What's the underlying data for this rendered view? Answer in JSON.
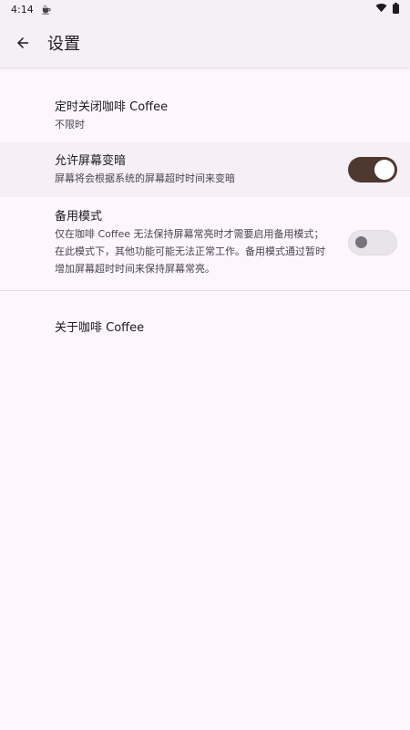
{
  "status_bar": {
    "time": "4:14"
  },
  "app_bar": {
    "title": "设置"
  },
  "settings": {
    "timer": {
      "title": "定时关闭咖啡 Coffee",
      "summary": "不限时"
    },
    "allow_dim": {
      "title": "允许屏幕变暗",
      "summary": "屏幕将会根据系统的屏幕超时时间来变暗",
      "enabled": true
    },
    "backup_mode": {
      "title": "备用模式",
      "summary": "仅在咖啡 Coffee 无法保持屏幕常亮时才需要启用备用模式；在此模式下，其他功能可能无法正常工作。备用模式通过暂时增加屏幕超时时间来保持屏幕常亮。",
      "enabled": false
    },
    "about": {
      "title": "关于咖啡 Coffee"
    }
  },
  "colors": {
    "switch_on_track": "#4e3830",
    "background": "#fdf7fd"
  }
}
